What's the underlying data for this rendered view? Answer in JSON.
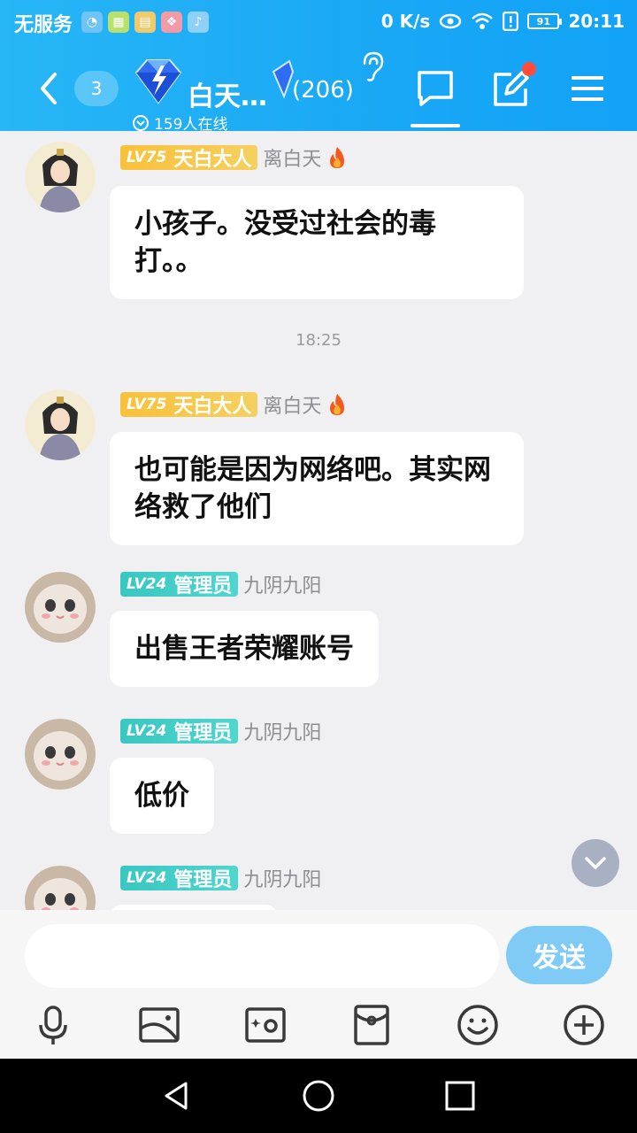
{
  "status_bar": {
    "carrier": "无服务",
    "network_speed": "0 K/s",
    "battery": "91",
    "time": "20:11"
  },
  "header": {
    "unread_count": "3",
    "group_name": "白天…",
    "member_count": "(206)",
    "online_text": "159人在线"
  },
  "messages": [
    {
      "level": "LV75",
      "title": "天白大人",
      "nickname": "离白天",
      "text": "小孩子。没受过社会的毒打。。",
      "badge_color": "#f8c13a"
    },
    {
      "level": "LV75",
      "title": "天白大人",
      "nickname": "离白天",
      "text": "也可能是因为网络吧。其实网络救了他们",
      "badge_color": "#f8c13a"
    },
    {
      "level": "LV24",
      "title": "管理员",
      "nickname": "九阴九阳",
      "text": "出售王者荣耀账号",
      "badge_color": "#39c7c1"
    },
    {
      "level": "LV24",
      "title": "管理员",
      "nickname": "九阴九阳",
      "text": "低价",
      "badge_color": "#39c7c1"
    },
    {
      "level": "LV24",
      "title": "管理员",
      "nickname": "九阴九阳",
      "text": "",
      "badge_color": "#39c7c1"
    }
  ],
  "timestamp": "18:25",
  "composer": {
    "placeholder": "",
    "send_label": "发送"
  },
  "toolbar_icons": [
    "microphone-icon",
    "image-icon",
    "camera-icon",
    "red-packet-icon",
    "emoji-icon",
    "plus-icon"
  ],
  "colors": {
    "header_blue": "#1aa9f5",
    "send_button": "#7fcbf6",
    "notification_dot": "#ff4d3a"
  }
}
